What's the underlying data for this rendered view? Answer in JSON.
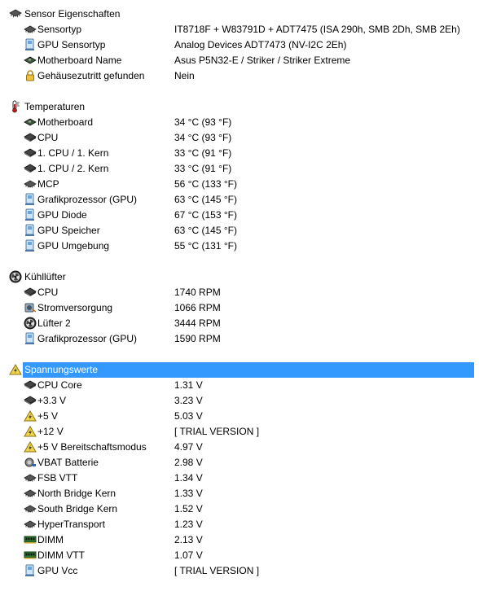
{
  "sections": [
    {
      "title": "Sensor Eigenschaften",
      "icon": "sensor-chip-icon",
      "selected": false,
      "items": [
        {
          "label": "Sensortyp",
          "value": "IT8718F + W83791D + ADT7475  (ISA 290h, SMB 2Dh, SMB 2Eh)",
          "icon": "chip-icon"
        },
        {
          "label": "GPU Sensortyp",
          "value": "Analog Devices ADT7473  (NV-I2C 2Eh)",
          "icon": "gpu-icon"
        },
        {
          "label": "Motherboard Name",
          "value": "Asus P5N32-E / Striker / Striker Extreme",
          "icon": "motherboard-icon"
        },
        {
          "label": "Gehäusezutritt gefunden",
          "value": "Nein",
          "icon": "lock-icon"
        }
      ]
    },
    {
      "title": "Temperaturen",
      "icon": "thermometer-icon",
      "selected": false,
      "items": [
        {
          "label": "Motherboard",
          "value": "34 °C  (93 °F)",
          "icon": "motherboard-icon"
        },
        {
          "label": "CPU",
          "value": "34 °C  (93 °F)",
          "icon": "cpu-icon"
        },
        {
          "label": "1. CPU / 1. Kern",
          "value": "33 °C  (91 °F)",
          "icon": "cpu-icon"
        },
        {
          "label": "1. CPU / 2. Kern",
          "value": "33 °C  (91 °F)",
          "icon": "cpu-icon"
        },
        {
          "label": "MCP",
          "value": "56 °C  (133 °F)",
          "icon": "chip-icon"
        },
        {
          "label": "Grafikprozessor (GPU)",
          "value": "63 °C  (145 °F)",
          "icon": "gpu-icon"
        },
        {
          "label": "GPU Diode",
          "value": "67 °C  (153 °F)",
          "icon": "gpu-icon"
        },
        {
          "label": "GPU Speicher",
          "value": "63 °C  (145 °F)",
          "icon": "gpu-icon"
        },
        {
          "label": "GPU Umgebung",
          "value": "55 °C  (131 °F)",
          "icon": "gpu-icon"
        }
      ]
    },
    {
      "title": "Kühllüfter",
      "icon": "fan-icon",
      "selected": false,
      "items": [
        {
          "label": "CPU",
          "value": "1740 RPM",
          "icon": "cpu-icon"
        },
        {
          "label": "Stromversorgung",
          "value": "1066 RPM",
          "icon": "power-supply-icon"
        },
        {
          "label": "Lüfter 2",
          "value": "3444 RPM",
          "icon": "fan-icon"
        },
        {
          "label": "Grafikprozessor (GPU)",
          "value": "1590 RPM",
          "icon": "gpu-icon"
        }
      ]
    },
    {
      "title": "Spannungswerte",
      "icon": "voltage-icon",
      "selected": true,
      "items": [
        {
          "label": "CPU Core",
          "value": "1.31 V",
          "icon": "cpu-icon"
        },
        {
          "label": "+3.3 V",
          "value": "3.23 V",
          "icon": "cpu-icon"
        },
        {
          "label": "+5 V",
          "value": "5.03 V",
          "icon": "voltage-icon"
        },
        {
          "label": "+12 V",
          "value": "[ TRIAL VERSION ]",
          "icon": "voltage-icon"
        },
        {
          "label": "+5 V Bereitschaftsmodus",
          "value": "4.97 V",
          "icon": "voltage-icon"
        },
        {
          "label": "VBAT Batterie",
          "value": "2.98 V",
          "icon": "battery-icon"
        },
        {
          "label": "FSB VTT",
          "value": "1.34 V",
          "icon": "chip-icon"
        },
        {
          "label": "North Bridge Kern",
          "value": "1.33 V",
          "icon": "chip-icon"
        },
        {
          "label": "South Bridge Kern",
          "value": "1.52 V",
          "icon": "chip-icon"
        },
        {
          "label": "HyperTransport",
          "value": "1.23 V",
          "icon": "chip-icon"
        },
        {
          "label": "DIMM",
          "value": "2.13 V",
          "icon": "memory-icon"
        },
        {
          "label": "DIMM VTT",
          "value": "1.07 V",
          "icon": "memory-icon"
        },
        {
          "label": "GPU Vcc",
          "value": "[ TRIAL VERSION ]",
          "icon": "gpu-icon"
        }
      ]
    }
  ],
  "colors": {
    "selection": "#3399ff",
    "selection_text": "#ffffff"
  }
}
